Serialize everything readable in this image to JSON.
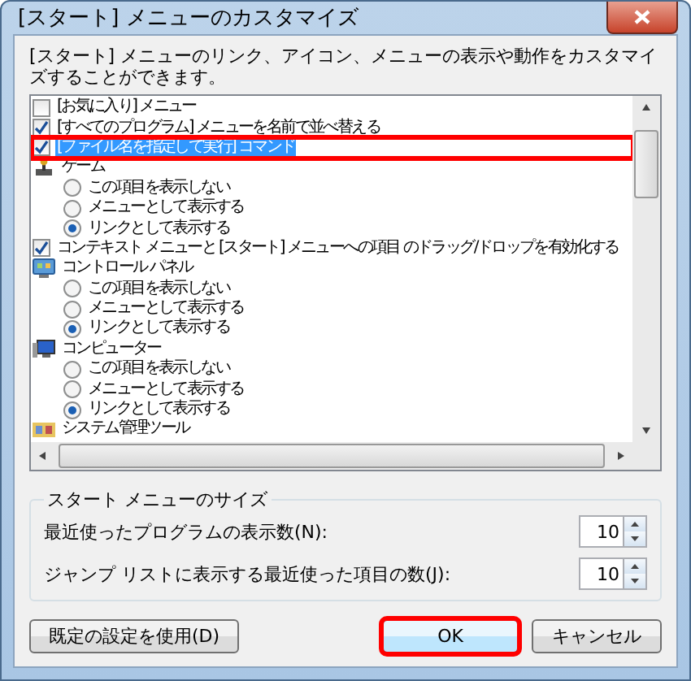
{
  "window": {
    "title": "[スタート] メニューのカスタマイズ"
  },
  "description": "[スタート] メニューのリンク、アイコン、メニューの表示や動作をカスタマイズすることができます。",
  "options": [
    {
      "kind": "checkbox",
      "label": "[お気に入り] メニュー",
      "checked": false,
      "selected": false,
      "highlighted": false
    },
    {
      "kind": "checkbox",
      "label": "[すべてのプログラム] メニューを名前で並べ替える",
      "checked": true,
      "selected": false,
      "highlighted": false
    },
    {
      "kind": "checkbox",
      "label": "[ファイル名を指定して実行] コマンド",
      "checked": true,
      "selected": true,
      "highlighted": true
    },
    {
      "kind": "category",
      "label": "ゲーム",
      "children": [
        {
          "label": "この項目を表示しない",
          "selected": false
        },
        {
          "label": "メニューとして表示する",
          "selected": false
        },
        {
          "label": "リンクとして表示する",
          "selected": true
        }
      ]
    },
    {
      "kind": "checkbox",
      "label": "コンテキスト メニューと [スタート] メニューへの項目 のドラッグ/ドロップを有効化する",
      "checked": true,
      "selected": false,
      "highlighted": false
    },
    {
      "kind": "category",
      "label": "コントロール パネル",
      "children": [
        {
          "label": "この項目を表示しない",
          "selected": false
        },
        {
          "label": "メニューとして表示する",
          "selected": false
        },
        {
          "label": "リンクとして表示する",
          "selected": true
        }
      ]
    },
    {
      "kind": "category",
      "label": "コンピューター",
      "children": [
        {
          "label": "この項目を表示しない",
          "selected": false
        },
        {
          "label": "メニューとして表示する",
          "selected": false
        },
        {
          "label": "リンクとして表示する",
          "selected": true
        }
      ]
    },
    {
      "kind": "category",
      "label": "システム管理ツール"
    }
  ],
  "size_group": {
    "title": "スタート メニューのサイズ",
    "fields": [
      {
        "label": "最近使ったプログラムの表示数(N):",
        "value": "10"
      },
      {
        "label": "ジャンプ リストに表示する最近使った項目の数(J):",
        "value": "10"
      }
    ]
  },
  "buttons": [
    {
      "label": "既定の設定を使用(D)",
      "highlighted": false,
      "default": false
    },
    {
      "label": "OK",
      "highlighted": true,
      "default": true
    },
    {
      "label": "キャンセル",
      "highlighted": false,
      "default": false
    }
  ]
}
